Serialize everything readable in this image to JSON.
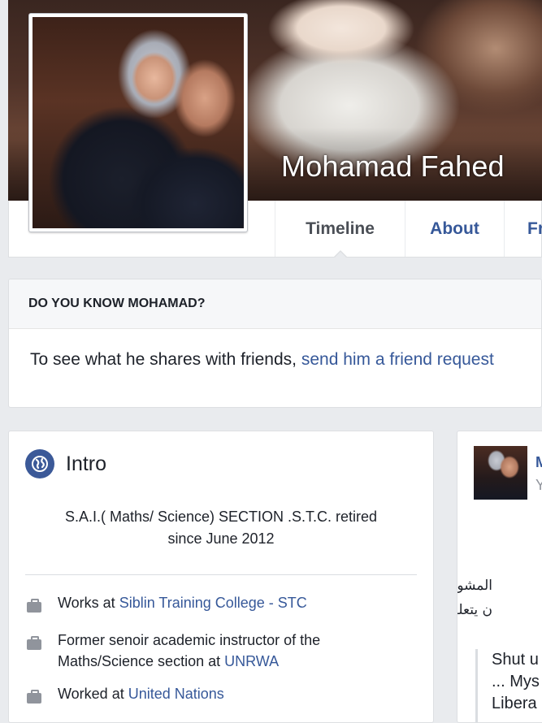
{
  "profile": {
    "name": "Mohamad Fahed"
  },
  "nav": {
    "tabs": [
      {
        "label": "Timeline",
        "active": true
      },
      {
        "label": "About",
        "active": false
      },
      {
        "label": "Fri",
        "active": false
      }
    ]
  },
  "know_card": {
    "heading": "DO YOU KNOW MOHAMAD?",
    "text": "To see what he shares with friends, ",
    "link": "send him a friend request"
  },
  "intro": {
    "title": "Intro",
    "icon": "globe-icon",
    "bio_line1": "S.A.I.( Maths/ Science) SECTION .S.T.C. retired",
    "bio_line2": "since June 2012",
    "facts": [
      {
        "icon": "briefcase-icon",
        "prefix": "Works at ",
        "link": "Siblin Training College - STC"
      },
      {
        "icon": "briefcase-icon",
        "prefix": "Former senoir academic instructor of the Maths/Science section at ",
        "link": "UNRWA"
      },
      {
        "icon": "briefcase-icon",
        "prefix": "Worked at ",
        "link": "United Nations"
      }
    ]
  },
  "post": {
    "name_partial": "M",
    "sub_partial": "Y",
    "arabic_line1": "المشوار .",
    "arabic_line2": "ن يتعلق",
    "quote_lines": [
      "Shut u",
      "... Mys",
      "Libera"
    ]
  },
  "colors": {
    "page_bg": "#e9ebee",
    "link": "#365899",
    "brand": "#3b5998",
    "muted": "#90949c"
  }
}
